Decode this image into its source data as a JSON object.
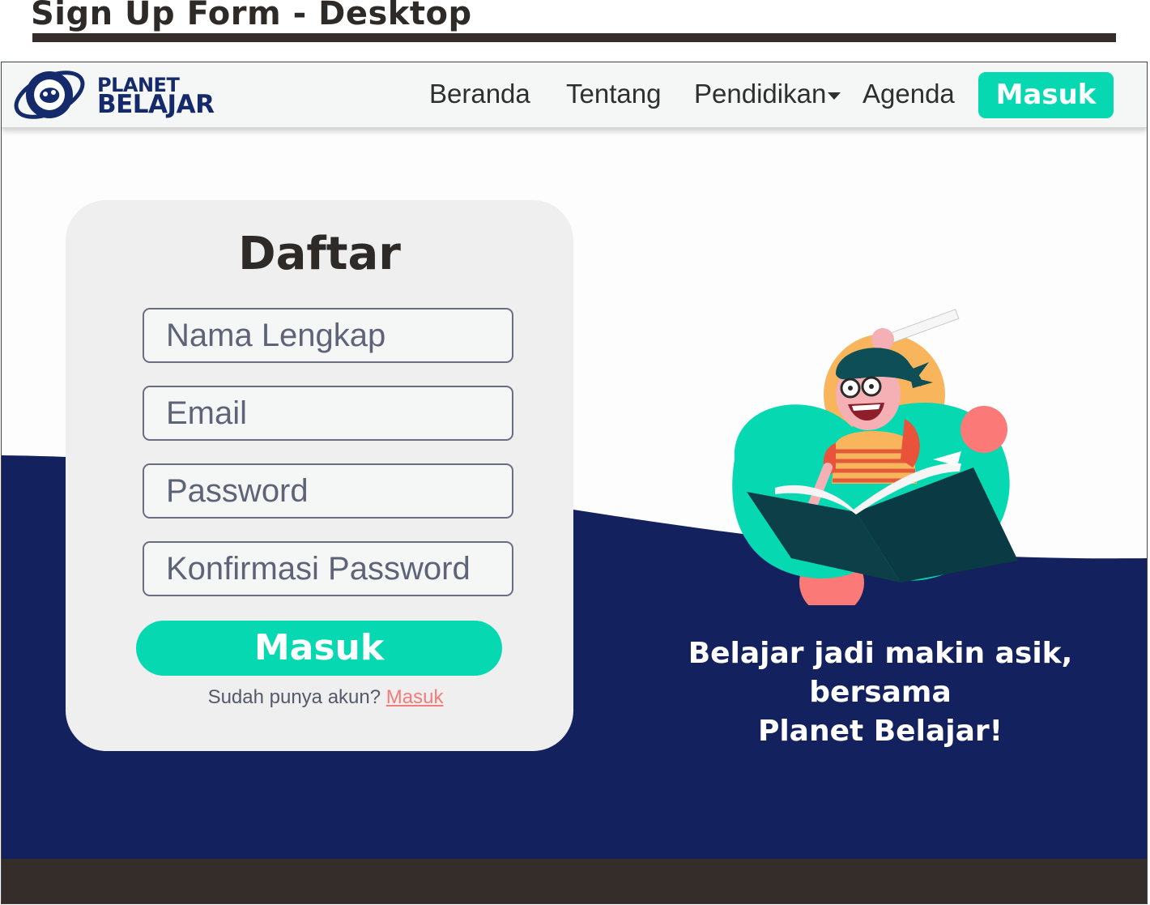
{
  "doc": {
    "title": "Sign Up Form - Desktop"
  },
  "navbar": {
    "logo_top": "PLANET",
    "logo_bottom": "BELAJAR",
    "items": [
      {
        "label": "Beranda"
      },
      {
        "label": "Tentang"
      },
      {
        "label": "Pendidikan",
        "has_dropdown": true
      },
      {
        "label": "Agenda"
      }
    ],
    "cta_label": "Masuk"
  },
  "form": {
    "title": "Daftar",
    "fields": [
      {
        "placeholder": "Nama Lengkap"
      },
      {
        "placeholder": "Email"
      },
      {
        "placeholder": "Password"
      },
      {
        "placeholder": "Konfirmasi Password"
      }
    ],
    "submit_label": "Masuk",
    "signin_prompt": "Sudah punya akun?",
    "signin_link": "Masuk"
  },
  "hero": {
    "tagline_line1": "Belajar jadi makin asik, bersama",
    "tagline_line2": "Planet Belajar!"
  },
  "colors": {
    "navy": "#13225e",
    "accent": "#06d9b1",
    "coral": "#f57b7b",
    "dark": "#352d2a"
  }
}
